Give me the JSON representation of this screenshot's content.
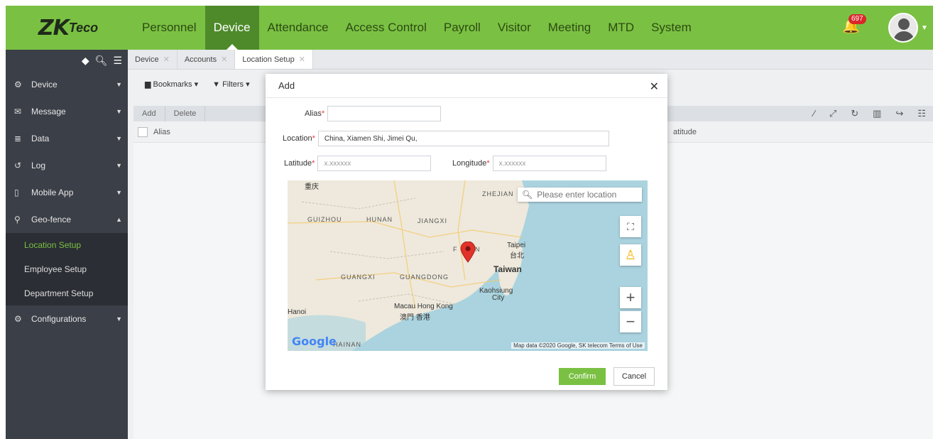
{
  "header": {
    "logo_main": "ZK",
    "logo_sub": "Teco",
    "nav": [
      "Personnel",
      "Device",
      "Attendance",
      "Access Control",
      "Payroll",
      "Visitor",
      "Meeting",
      "MTD",
      "System"
    ],
    "active_nav": "Device",
    "notifications": "697"
  },
  "sidebar": {
    "items": [
      {
        "label": "Device",
        "icon": "device-icon"
      },
      {
        "label": "Message",
        "icon": "message-icon"
      },
      {
        "label": "Data",
        "icon": "data-icon"
      },
      {
        "label": "Log",
        "icon": "log-icon"
      },
      {
        "label": "Mobile App",
        "icon": "mobile-icon"
      },
      {
        "label": "Geo-fence",
        "icon": "location-pin-icon"
      }
    ],
    "sub_items": [
      "Location Setup",
      "Employee Setup",
      "Department Setup"
    ],
    "config_label": "Configurations"
  },
  "tabs": [
    "Device",
    "Accounts",
    "Location Setup"
  ],
  "toolbar": {
    "bookmarks": "Bookmarks",
    "filters": "Filters",
    "add": "Add",
    "delete": "Delete"
  },
  "grid": {
    "col_alias": "Alias",
    "col_latitude": "atitude"
  },
  "modal": {
    "title": "Add",
    "alias_label": "Alias",
    "alias_value": "",
    "location_label": "Location",
    "location_value": "China, Xiamen Shi, Jimei Qu,",
    "latitude_label": "Latitude",
    "latitude_placeholder": "x.xxxxxx",
    "longitude_label": "Longitude",
    "longitude_placeholder": "x.xxxxxx",
    "map_search_placeholder": "Please enter location",
    "map_labels": {
      "chongqing": "重庆",
      "zhejiang": "ZHEJIAN",
      "guizhou": "GUIZHOU",
      "hunan": "HUNAN",
      "jiangxi": "JIANGXI",
      "fujian_a": "F",
      "fujian_b": "N",
      "taipei": "Taipei",
      "taipei_cn": "台北",
      "taiwan": "Taiwan",
      "guangxi": "GUANGXI",
      "guangdong": "GUANGDONG",
      "kaohsiung": "Kaohsiung",
      "city": "City",
      "macau_hk": "Macau Hong Kong",
      "macau_hk_cn": "澳門 香港",
      "hanoi": "Hanoi",
      "hainan": "HAINAN"
    },
    "map_footer": "Map data ©2020 Google, SK telecom   Terms of Use",
    "google": "Google",
    "confirm": "Confirm",
    "cancel": "Cancel"
  }
}
